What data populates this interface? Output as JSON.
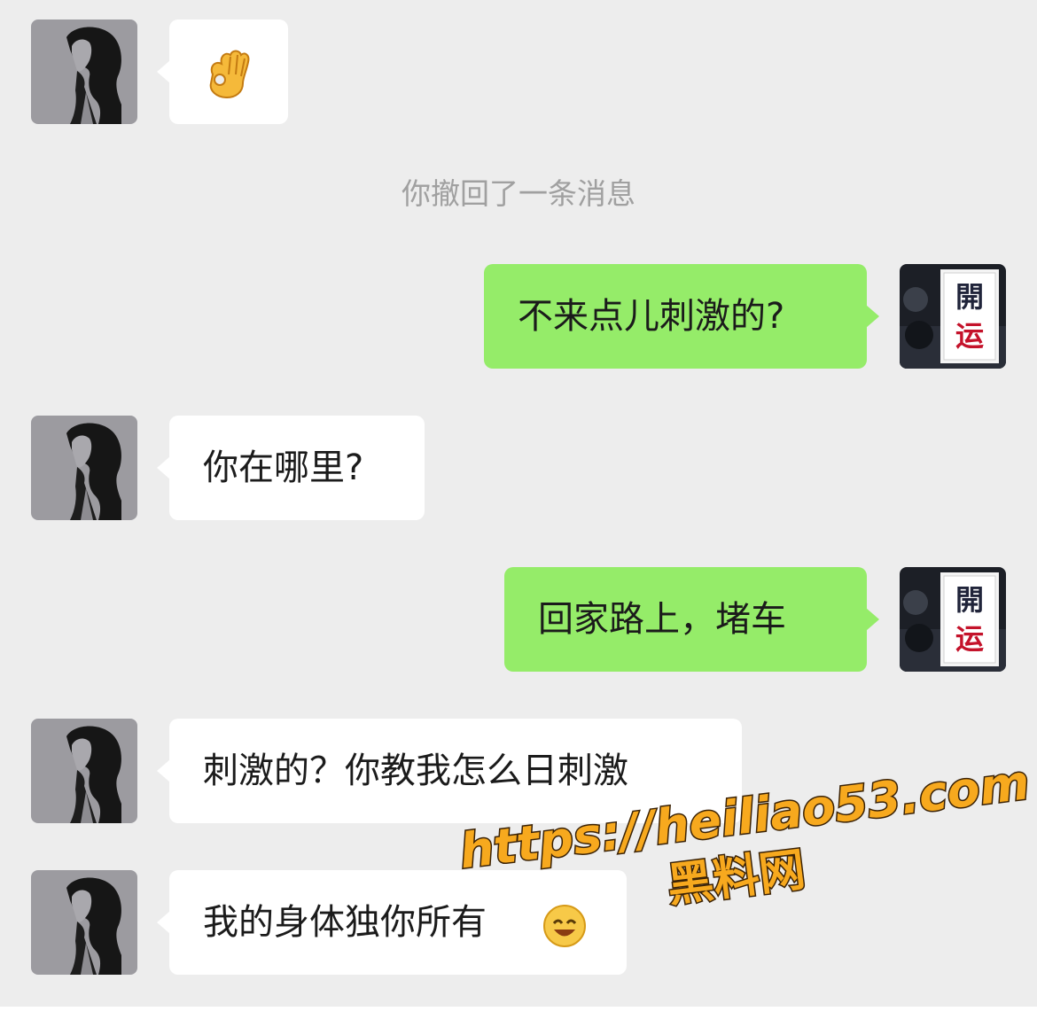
{
  "conversation": {
    "messages": [
      {
        "side": "left",
        "type": "emoji",
        "emoji": "ok-hand-icon"
      },
      {
        "side": "center",
        "type": "system",
        "text": "你撤回了一条消息"
      },
      {
        "side": "right",
        "type": "text",
        "text": "不来点儿刺激的?"
      },
      {
        "side": "left",
        "type": "text",
        "text": "你在哪里?"
      },
      {
        "side": "right",
        "type": "text",
        "text": "回家路上，堵车"
      },
      {
        "side": "left",
        "type": "text",
        "text": "刺激的？你教我怎么日刺激"
      },
      {
        "side": "left",
        "type": "text",
        "text": "我的身体独你所有",
        "trailing_emoji": "laughing-face-icon"
      }
    ]
  },
  "avatars": {
    "contact": "woman-silhouette-avatar",
    "self": "kaiyun-logo-avatar",
    "self_logo_text": "開运"
  },
  "watermark": {
    "url": "https://heiliao53.com",
    "name": "黑料网"
  },
  "colors": {
    "chat_background": "#ededed",
    "incoming_bubble": "#ffffff",
    "outgoing_bubble": "#95ec69",
    "system_text": "#a0a0a0",
    "watermark_fill": "#f7a91e"
  }
}
